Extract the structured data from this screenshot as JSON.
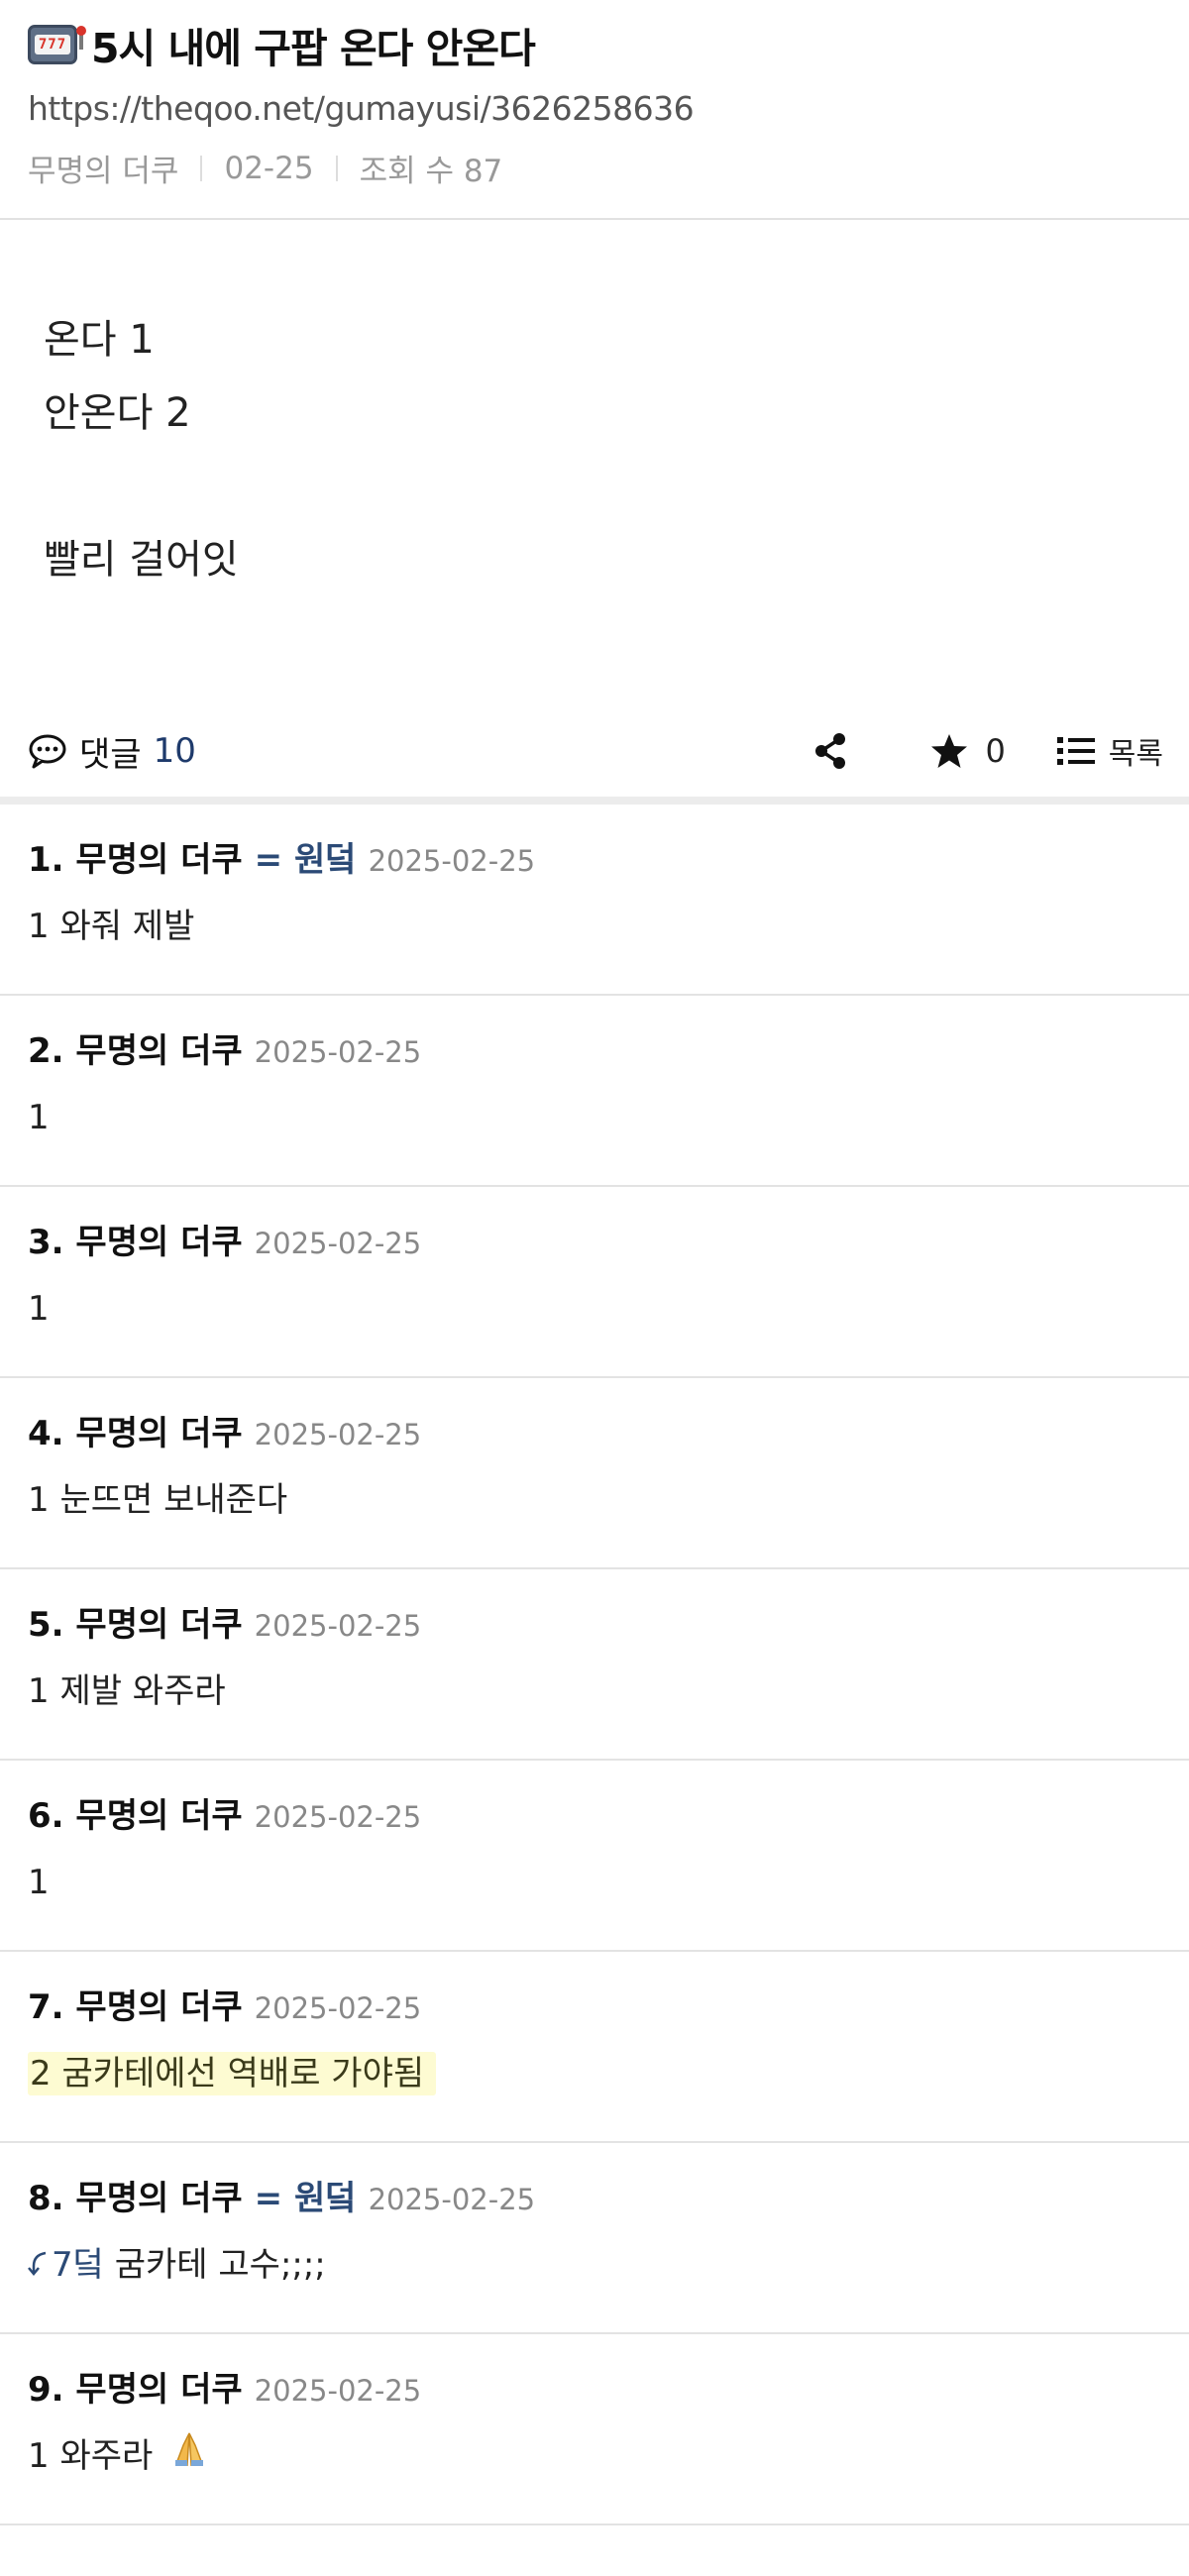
{
  "post": {
    "title": "5시 내에 구팝 온다 안온다",
    "title_icon": "slot-machine-icon",
    "url": "https://theqoo.net/gumayusi/3626258636",
    "author": "무명의 더쿠",
    "date": "02-25",
    "views_label": "조회 수 87",
    "body_lines": [
      "온다 1",
      "안온다 2",
      "",
      "빨리 걸어잇"
    ]
  },
  "actions": {
    "comments_label": "댓글",
    "comments_count": "10",
    "star_count": "0",
    "list_label": "목록"
  },
  "comments": [
    {
      "num": "1.",
      "author": "무명의 더쿠",
      "tag": "= 원덬",
      "date": "2025-02-25",
      "text": "1 와줘 제발"
    },
    {
      "num": "2.",
      "author": "무명의 더쿠",
      "tag": "",
      "date": "2025-02-25",
      "text": "1"
    },
    {
      "num": "3.",
      "author": "무명의 더쿠",
      "tag": "",
      "date": "2025-02-25",
      "text": "1"
    },
    {
      "num": "4.",
      "author": "무명의 더쿠",
      "tag": "",
      "date": "2025-02-25",
      "text": "1 눈뜨면 보내준다"
    },
    {
      "num": "5.",
      "author": "무명의 더쿠",
      "tag": "",
      "date": "2025-02-25",
      "text": "1 제발 와주라"
    },
    {
      "num": "6.",
      "author": "무명의 더쿠",
      "tag": "",
      "date": "2025-02-25",
      "text": "1"
    },
    {
      "num": "7.",
      "author": "무명의 더쿠",
      "tag": "",
      "date": "2025-02-25",
      "text": "2 굼카테에선 역배로 가야됨"
    },
    {
      "num": "8.",
      "author": "무명의 더쿠",
      "tag": "= 원덬",
      "date": "2025-02-25",
      "mention": "7덬",
      "text": "굼카테 고수;;;;"
    },
    {
      "num": "9.",
      "author": "무명의 더쿠",
      "tag": "",
      "date": "2025-02-25",
      "text": "1 와주라"
    }
  ],
  "colors": {
    "accent": "#2b4a76",
    "highlight": "#fdfbd2",
    "divider": "#e3e3e3"
  }
}
